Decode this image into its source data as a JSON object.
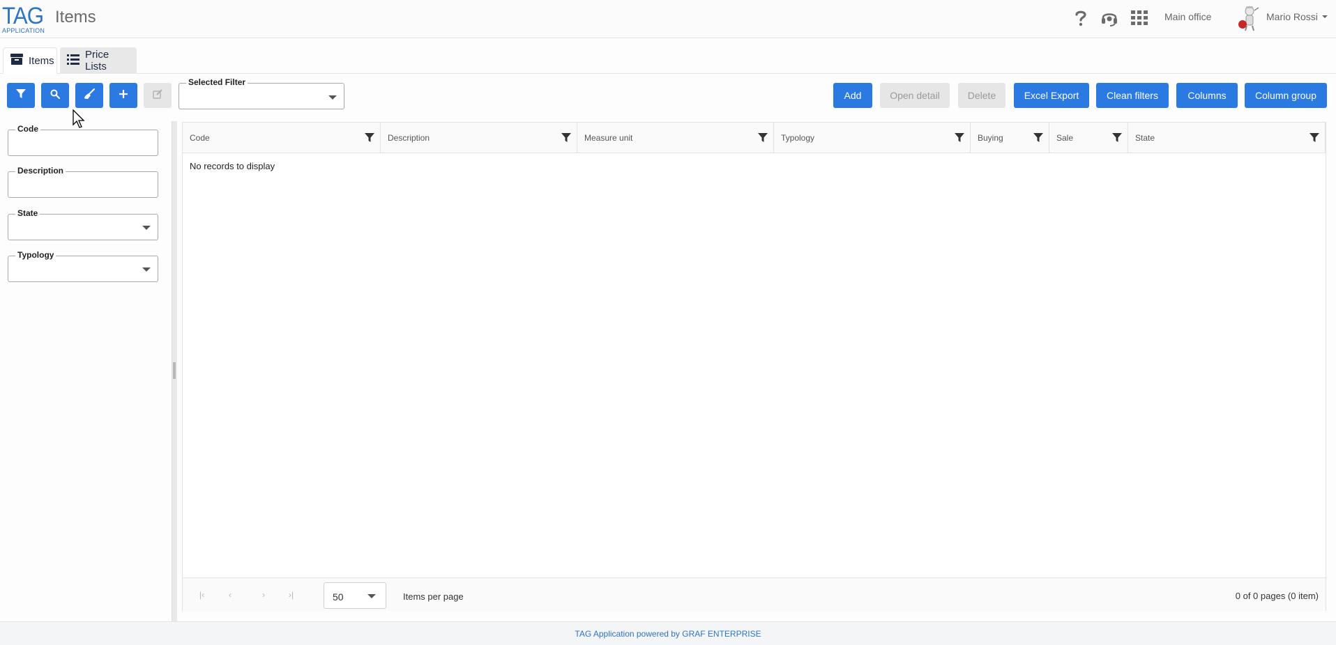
{
  "header": {
    "logo_main": "TAG",
    "logo_sub": "APPLICATION",
    "title": "Items",
    "office": "Main office",
    "user_name": "Mario Rossi",
    "icons": [
      "help-icon",
      "support-headset-icon",
      "apps-grid-icon"
    ]
  },
  "tabs": [
    {
      "label": "Items",
      "icon": "box-icon",
      "active": true
    },
    {
      "label": "Price Lists",
      "icon": "list-icon",
      "active": false
    }
  ],
  "toolbar": {
    "icon_buttons": [
      "filter-icon",
      "search-icon",
      "broom-icon",
      "plus-icon",
      "edit-icon"
    ],
    "selected_filter_label": "Selected Filter",
    "selected_filter_value": "",
    "actions": {
      "add": "Add",
      "open_detail": "Open detail",
      "delete": "Delete",
      "excel_export": "Excel Export",
      "clean_filters": "Clean filters",
      "columns": "Columns",
      "column_group": "Column group"
    }
  },
  "filters": {
    "code_label": "Code",
    "description_label": "Description",
    "state_label": "State",
    "typology_label": "Typology"
  },
  "grid": {
    "columns": [
      "Code",
      "Description",
      "Measure unit",
      "Typology",
      "Buying",
      "Sale",
      "State"
    ],
    "empty_message": "No records to display",
    "page_size": "50",
    "per_page_label": "Items per page",
    "page_info": "0 of 0 pages (0 item)"
  },
  "footer": {
    "text": "TAG Application powered by GRAF ENTERPRISE"
  },
  "colors": {
    "primary": "#2a7ae2",
    "brand": "#2f73c4",
    "disabled": "#e6e6e6"
  }
}
